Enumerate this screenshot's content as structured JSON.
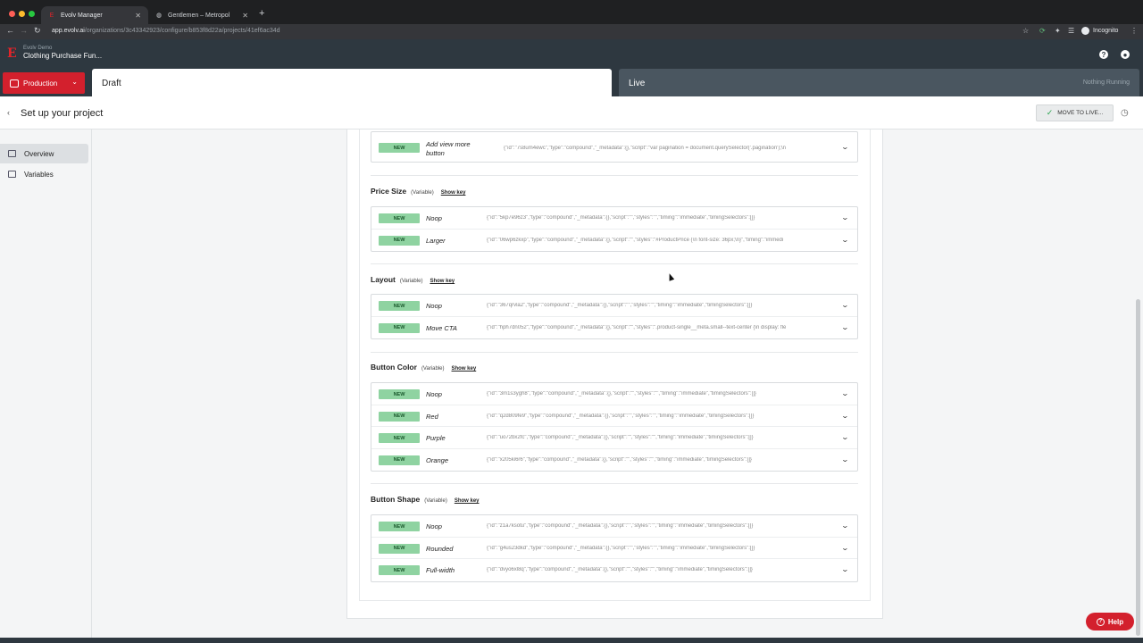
{
  "browser": {
    "tabs": [
      {
        "title": "Evolv Manager",
        "favicon": "evolv-logo-icon"
      },
      {
        "title": "Gentlemen – Metropol",
        "favicon": "globe-icon"
      }
    ],
    "url_host": "app.evolv.ai",
    "url_path": "/organizations/3c43342923/configure/b853f8d22a/projects/41ef6ac34d",
    "profile": "Incognito"
  },
  "header": {
    "org": "Evolv Demo",
    "project": "Clothing Purchase Fun...",
    "environment": "Production",
    "tabs": {
      "draft": "Draft",
      "live": "Live",
      "live_status": "Nothing Running"
    }
  },
  "subheader": {
    "back_icon": "chevron-left-icon",
    "title": "Set up your project",
    "move_button": "MOVE TO LIVE..."
  },
  "sidebar": {
    "items": [
      {
        "label": "Overview",
        "icon": "grid-icon",
        "active": true
      },
      {
        "label": "Variables",
        "icon": "camera-icon",
        "active": false
      }
    ]
  },
  "variables": {
    "badge_label": "NEW",
    "variable_tag": "(Variable)",
    "show_key": "Show key",
    "first": {
      "name": "Add view more button",
      "json": "{\"id\":\"7s8um4ewc\",\"type\":\"compound\",\"_metadata\":{},\"script\":\"var pagination = document.querySelector('.pagination');\\n"
    },
    "groups": [
      {
        "title": "Price Size",
        "variants": [
          {
            "name": "Noop",
            "json": "{\"id\":\"5kp7e96z3\",\"type\":\"compound\",\"_metadata\":{},\"script\":\"\",\"styles\":\"\",\"timing\":\"immediate\",\"timingSelectors\":[]}"
          },
          {
            "name": "Larger",
            "json": "{\"id\":\"06wp6zkxp\",\"type\":\"compound\",\"_metadata\":{},\"script\":\"\",\"styles\":\"#ProductPrice {\\n font-size: 36px;\\n}\",\"timing\":\"immedi"
          }
        ]
      },
      {
        "title": "Layout",
        "variants": [
          {
            "name": "Noop",
            "json": "{\"id\":\"367qrvla2\",\"type\":\"compound\",\"_metadata\":{},\"script\":\"\",\"styles\":\"\",\"timing\":\"immediate\",\"timingSelectors\":[]}"
          },
          {
            "name": "Move CTA",
            "json": "{\"id\":\"hph7dn052\",\"type\":\"compound\",\"_metadata\":{},\"script\":\"\",\"styles\":\".product-single__meta.small--text-center {\\n display: fle"
          }
        ]
      },
      {
        "title": "Button Color",
        "variants": [
          {
            "name": "Noop",
            "json": "{\"id\":\"3m1s3ygh8\",\"type\":\"compound\",\"_metadata\":{},\"script\":\"\",\"styles\":\"\",\"timing\":\"immediate\",\"timingSelectors\":[]}"
          },
          {
            "name": "Red",
            "json": "{\"id\":\"q2d809fe9\",\"type\":\"compound\",\"_metadata\":{},\"script\":\"\",\"styles\":\"\",\"timing\":\"immediate\",\"timingSelectors\":[]}"
          },
          {
            "name": "Purple",
            "json": "{\"id\":\"uo72bx2fc\",\"type\":\"compound\",\"_metadata\":{},\"script\":\"\",\"styles\":\"\",\"timing\":\"immediate\",\"timingSelectors\":[]}"
          },
          {
            "name": "Orange",
            "json": "{\"id\":\"x205ki6r6\",\"type\":\"compound\",\"_metadata\":{},\"script\":\"\",\"styles\":\"\",\"timing\":\"immediate\",\"timingSelectors\":[]}"
          }
        ]
      },
      {
        "title": "Button Shape",
        "variants": [
          {
            "name": "Noop",
            "json": "{\"id\":\"z1a7ksotu\",\"type\":\"compound\",\"_metadata\":{},\"script\":\"\",\"styles\":\"\",\"timing\":\"immediate\",\"timingSelectors\":[]}"
          },
          {
            "name": "Rounded",
            "json": "{\"id\":\"g4us23dkd\",\"type\":\"compound\",\"_metadata\":{},\"script\":\"\",\"styles\":\"\",\"timing\":\"immediate\",\"timingSelectors\":[]}"
          },
          {
            "name": "Full-width",
            "json": "{\"id\":\"dvyo6xl8q\",\"type\":\"compound\",\"_metadata\":{},\"script\":\"\",\"styles\":\"\",\"timing\":\"immediate\",\"timingSelectors\":[]}"
          }
        ]
      }
    ]
  },
  "help": {
    "label": "Help",
    "icon": "help-icon"
  },
  "colors": {
    "brand_red": "#d3202d",
    "header_bg": "#2e3840",
    "badge_green": "#8fd3a1"
  }
}
